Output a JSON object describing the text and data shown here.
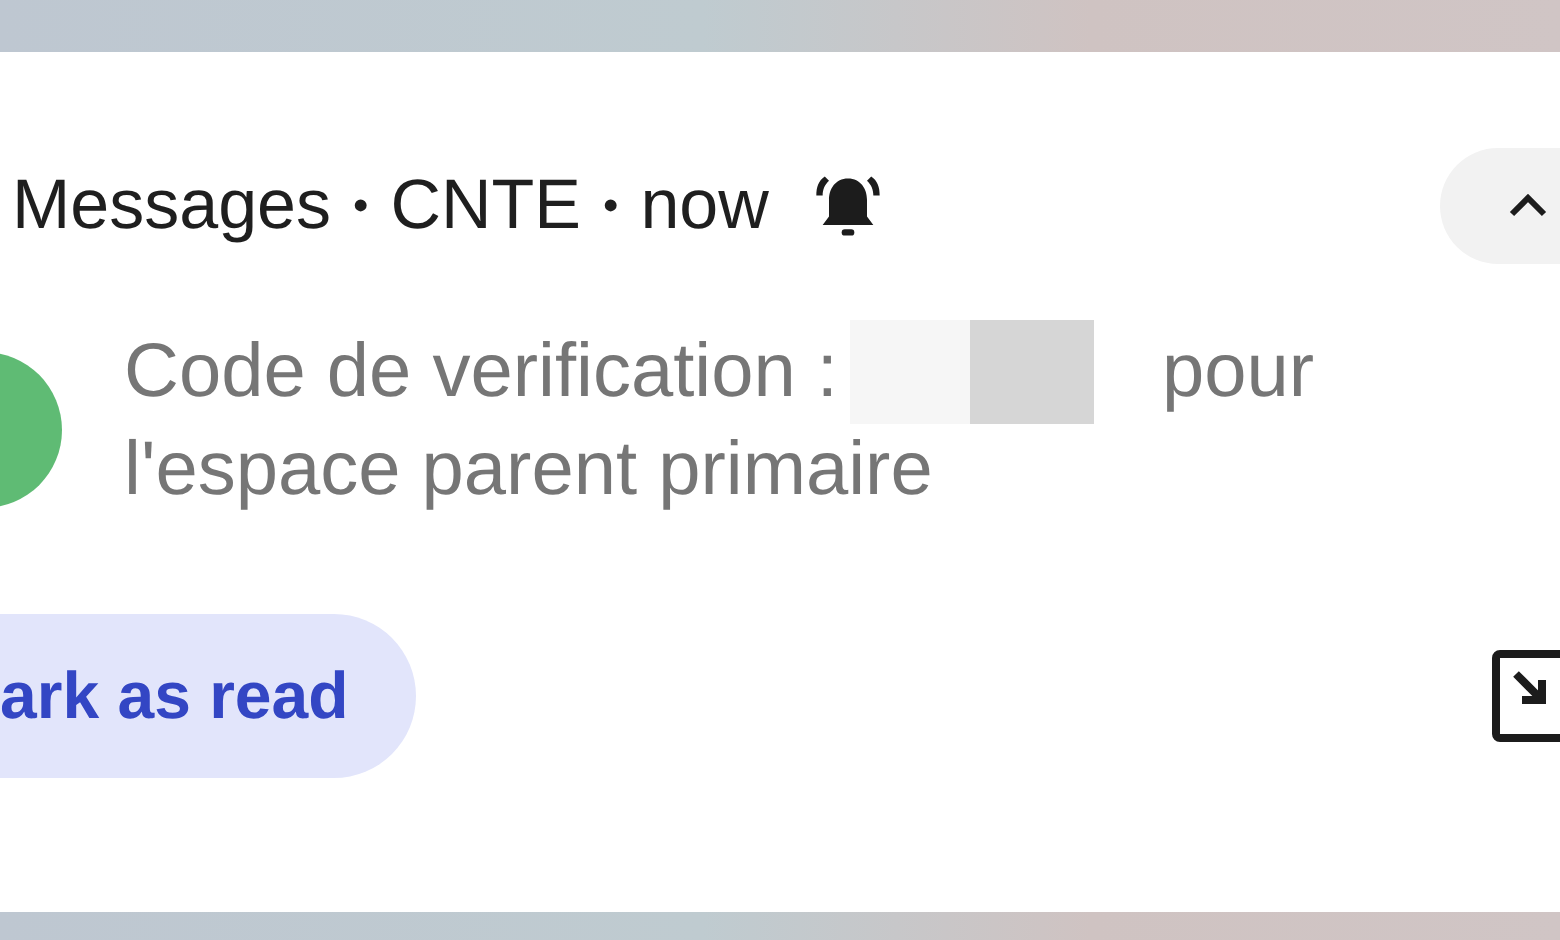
{
  "notification": {
    "app": "Messages",
    "separator_1": "•",
    "sender": "CNTE",
    "separator_2": "•",
    "time": "now",
    "alerting": true,
    "expanded": true,
    "message_line_1": "Code de verification :",
    "code_redacted": true,
    "message_line_1_end": "pour",
    "message_line_2": "l'espace parent primaire",
    "action": "ark as read"
  }
}
